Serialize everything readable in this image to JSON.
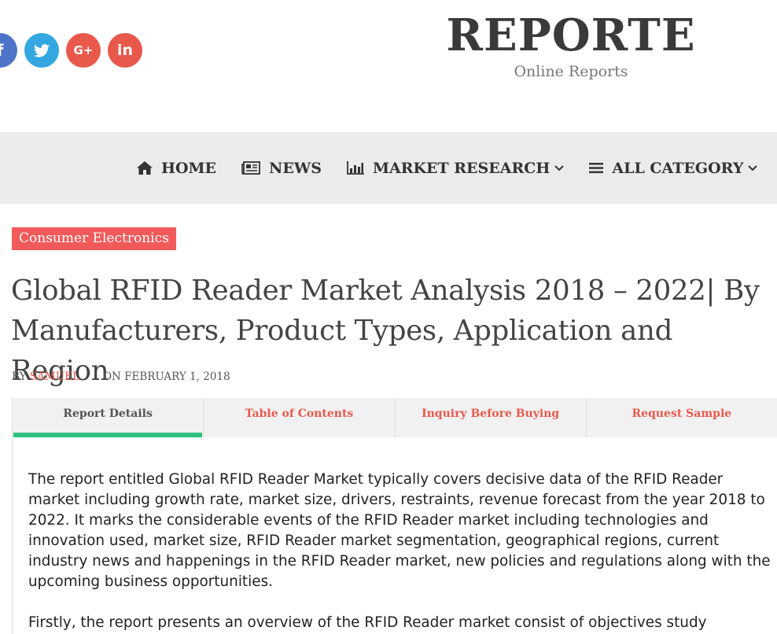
{
  "social": [
    {
      "name": "facebook",
      "glyph": "f",
      "color": "#4e74c9"
    },
    {
      "name": "twitter",
      "glyph": "t",
      "color": "#35a7e0"
    },
    {
      "name": "google-plus",
      "glyph": "G+",
      "color": "#e8594c"
    },
    {
      "name": "linkedin",
      "glyph": "in",
      "color": "#e8594c"
    }
  ],
  "logo": {
    "title": "REPORTE",
    "subtitle": "Online Reports"
  },
  "nav": {
    "home": "HOME",
    "news": "NEWS",
    "market_research": "MARKET RESEARCH",
    "all_category": "ALL CATEGORY",
    "chevron": "⌄"
  },
  "article": {
    "category": "Consumer Electronics",
    "title": "Global RFID Reader Market Analysis 2018 – 2022| By Manufacturers, Product Types, Application and Region",
    "by_label": "BY",
    "author": "SAMUEL",
    "date": "ON FEBRUARY 1, 2018"
  },
  "tabs": [
    {
      "label": "Report Details",
      "active": true
    },
    {
      "label": "Table of Contents",
      "active": false
    },
    {
      "label": "Inquiry Before Buying",
      "active": false
    },
    {
      "label": "Request Sample",
      "active": false
    }
  ],
  "content": {
    "p1": "The report entitled Global RFID Reader Market typically covers decisive data of the RFID Reader market including growth rate, market size, drivers, restraints, revenue forecast from the year 2018 to 2022. It marks the considerable events of the RFID Reader market including technologies and innovation used, market size, RFID Reader market segmentation, geographical regions, current industry news and happenings in the RFID Reader market, new policies and regulations along with the upcoming business opportunities.",
    "p2": "Firstly, the report presents an overview of the RFID Reader market consist of objectives study"
  },
  "colors": {
    "accent": "#e8594c",
    "tab_active_bar": "#2ec27e",
    "badge": "#f15a5a",
    "nav_bg": "#ebebeb"
  }
}
